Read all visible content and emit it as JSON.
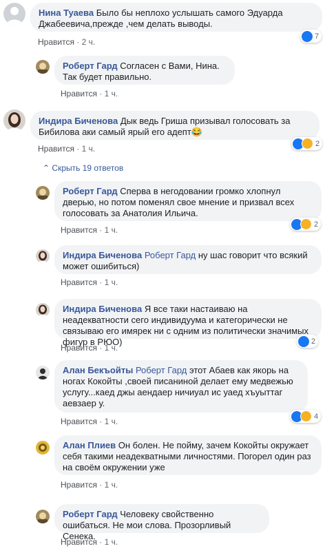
{
  "comments": [
    {
      "author": "Нина Туаева",
      "tag": "",
      "text": "Было бы неплохо услышать самого Эдуарда Джабеевича,прежде ,чем делать выводы.",
      "like_label": "Нравится",
      "time": "2 ч.",
      "reaction_count": "7"
    },
    {
      "author": "Роберт Гард",
      "tag": "",
      "text": "Согласен с Вами, Нина. Так будет правильно.",
      "like_label": "Нравится",
      "time": "1 ч.",
      "reaction_count": ""
    },
    {
      "author": "Индира Биченова",
      "tag": "",
      "text": "Дык ведь Гриша призывал голосовать за Бибилова аки самый ярый его адепт😂",
      "like_label": "Нравится",
      "time": "1 ч.",
      "reaction_count": "2"
    },
    {
      "author": "Роберт Гард",
      "tag": "",
      "text": "Сперва в негодовании громко хлопнул дверью, но потом поменял свое мнение и призвал всех голосовать за Анатолия Ильича.",
      "like_label": "Нравится",
      "time": "1 ч.",
      "reaction_count": "2"
    },
    {
      "author": "Индира Биченова",
      "tag": "Роберт Гард",
      "text": "ну шас говорит что всякий может ошибиться)",
      "like_label": "Нравится",
      "time": "1 ч.",
      "reaction_count": ""
    },
    {
      "author": "Индира Биченова",
      "tag": "",
      "text": "Я все таки настаиваю на неадекватности сего индивидуума и категорически не связываю его имярек ни с одним из политически значимых фигур в РЮО)",
      "like_label": "Нравится",
      "time": "1 ч.",
      "reaction_count": "2"
    },
    {
      "author": "Алан Бекъойты",
      "tag": "Роберт Гард",
      "text": "этот Абаев как якорь на ногах Кокойты ,своей писаниной делает ему медвежью услугу...каед джы аендаер ничиуал ис уаед хъуыттаг аевзаер у.",
      "like_label": "Нравится",
      "time": "1 ч.",
      "reaction_count": "4"
    },
    {
      "author": "Алан Плиев",
      "tag": "",
      "text": "Он болен. Не пойму, зачем Кокойты окружает себя такими неадекватными личностями. Погорел один раз на своём окружении уже",
      "like_label": "Нравится",
      "time": "1 ч.",
      "reaction_count": ""
    },
    {
      "author": "Роберт Гард",
      "tag": "",
      "text": "Человеку свойственно ошибаться. Не мои слова. Прозорливый Сенека.",
      "like_label": "Нравится",
      "time": "1 ч.",
      "reaction_count": ""
    }
  ],
  "hide_replies_label": "Скрыть 19 ответов",
  "separator": " · ",
  "colors": {
    "link": "#385898",
    "bubble": "#f2f3f5",
    "like_blue": "#1877f2",
    "haha_yellow": "#f7b125"
  }
}
